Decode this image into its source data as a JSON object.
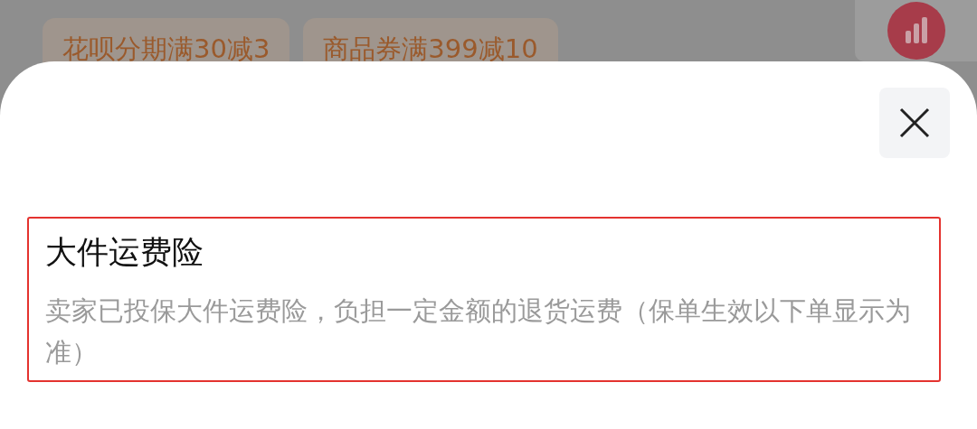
{
  "background": {
    "coupons": [
      {
        "label": "花呗分期满30减3"
      },
      {
        "label": "商品券满399减10"
      }
    ]
  },
  "sheet": {
    "section": {
      "title": "大件运费险",
      "description": "卖家已投保大件运费险，负担一定金额的退货运费（保单生效以下单显示为准）",
      "highlighted": true
    }
  }
}
